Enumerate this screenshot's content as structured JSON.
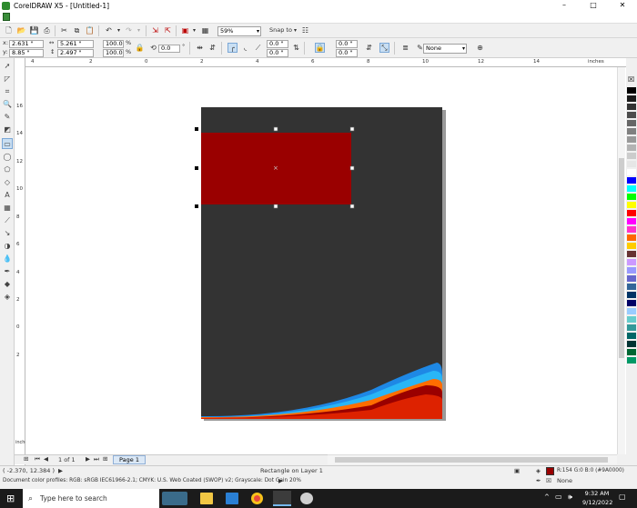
{
  "window": {
    "title": "CorelDRAW X5 - [Untitled-1]",
    "controls": [
      "–",
      "□",
      "✕"
    ]
  },
  "toolbar": {
    "zoom": "59%",
    "snap_to": "Snap to"
  },
  "propbar": {
    "x": "2.631 \"",
    "y": "8.85 \"",
    "w": "5.261 \"",
    "h": "2.497 \"",
    "scale_w": "100.0",
    "scale_h": "100.0",
    "pct": "%",
    "rotation": "0.0",
    "deg": "°",
    "corner_tl": "0.0 \"",
    "corner_bl": "0.0 \"",
    "corner_tr": "0.0 \"",
    "corner_br": "0.0 \"",
    "outline": "None"
  },
  "ruler": {
    "unit": "inches",
    "top_ticks": [
      "4",
      "2",
      "0",
      "2",
      "4",
      "6",
      "8",
      "10",
      "12",
      "14"
    ],
    "left_ticks": [
      "16",
      "14",
      "12",
      "10",
      "8",
      "6",
      "4",
      "2",
      "0",
      "2"
    ],
    "left_unit": "inches"
  },
  "pagenav": {
    "count": "1 of 1",
    "tab": "Page 1"
  },
  "status": {
    "coords": "( -2.370, 12.384 )",
    "object": "Rectangle on Layer 1",
    "fill_info": "R:154 G:0 B:0 (#9A0000)",
    "outline_info": "None",
    "profiles": "Document color profiles: RGB: sRGB IEC61966-2.1; CMYK: U.S. Web Coated (SWOP) v2; Grayscale: Dot Gain 20%"
  },
  "taskbar": {
    "search_placeholder": "Type here to search",
    "time": "9:32 AM",
    "date": "9/12/2022"
  },
  "colors": {
    "page_bg": "#333333",
    "rect_fill": "#9A0000",
    "palette": [
      "#000000",
      "#1a1a1a",
      "#333333",
      "#4d4d4d",
      "#666666",
      "#808080",
      "#999999",
      "#b3b3b3",
      "#cccccc",
      "#e6e6e6",
      "#ffffff",
      "#0000ff",
      "#00ffff",
      "#00ff00",
      "#ffff00",
      "#ff0000",
      "#ff00ff",
      "#ff33cc",
      "#ff6600",
      "#ffcc00",
      "#663333",
      "#cc99ff",
      "#9999ff",
      "#6666cc",
      "#336699",
      "#003366",
      "#000066",
      "#99ccff",
      "#66cccc",
      "#339999",
      "#006666",
      "#003333",
      "#006633",
      "#009966"
    ]
  }
}
